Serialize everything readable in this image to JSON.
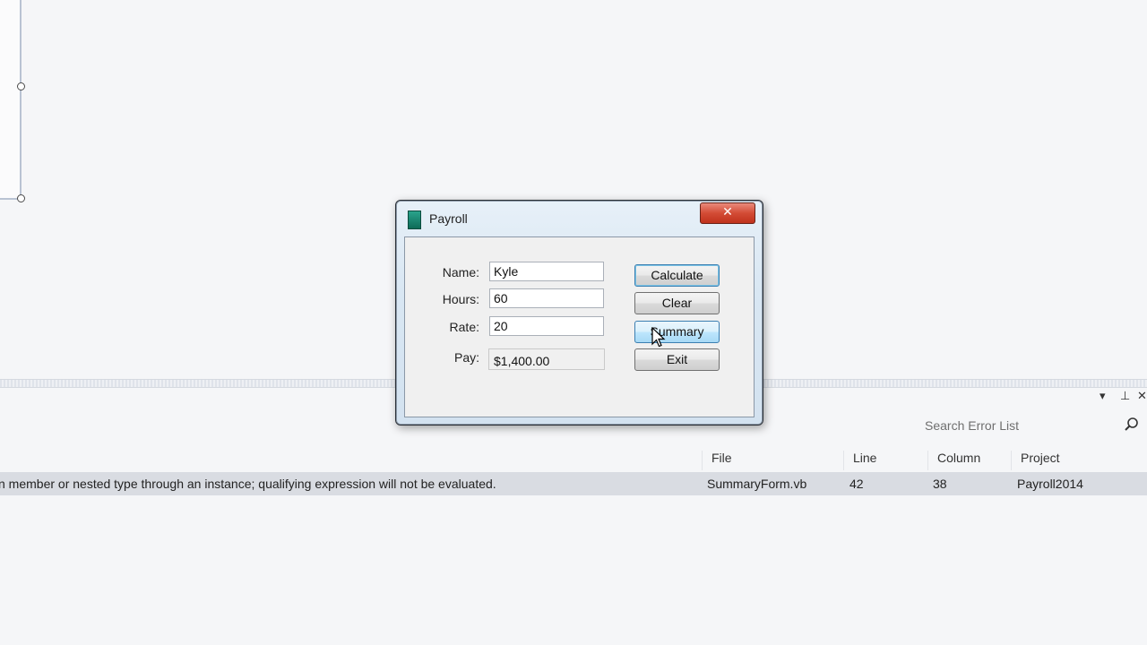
{
  "designer": {},
  "tool_window": {
    "search": {
      "placeholder": "Search Error List"
    },
    "columns": {
      "file": "File",
      "line": "Line",
      "column": "Column",
      "project": "Project"
    },
    "rows": [
      {
        "description": "n member or nested type through an instance; qualifying expression will not be evaluated.",
        "file": "SummaryForm.vb",
        "line": "42",
        "column": "38",
        "project": "Payroll2014"
      }
    ],
    "buttons": {
      "dropdown": "▾",
      "pin": "⊥",
      "close": "✕"
    }
  },
  "dialog": {
    "title": "Payroll",
    "close_label": "✕",
    "labels": {
      "name": "Name:",
      "hours": "Hours:",
      "rate": "Rate:",
      "pay": "Pay:"
    },
    "values": {
      "name": "Kyle",
      "hours": "60",
      "rate": "20",
      "pay": "$1,400.00"
    },
    "buttons": {
      "calculate": "Calculate",
      "clear": "Clear",
      "summary": "Summary",
      "exit": "Exit"
    }
  },
  "colors": {
    "dialog_titlebar": "#d9e7f3",
    "close_button": "#d34b35",
    "selected_row": "#d9dce2",
    "hover_button": "#bee6fd"
  },
  "icons": {
    "app": "payroll-app-icon",
    "search": "search-icon",
    "cursor": "mouse-cursor-icon"
  }
}
